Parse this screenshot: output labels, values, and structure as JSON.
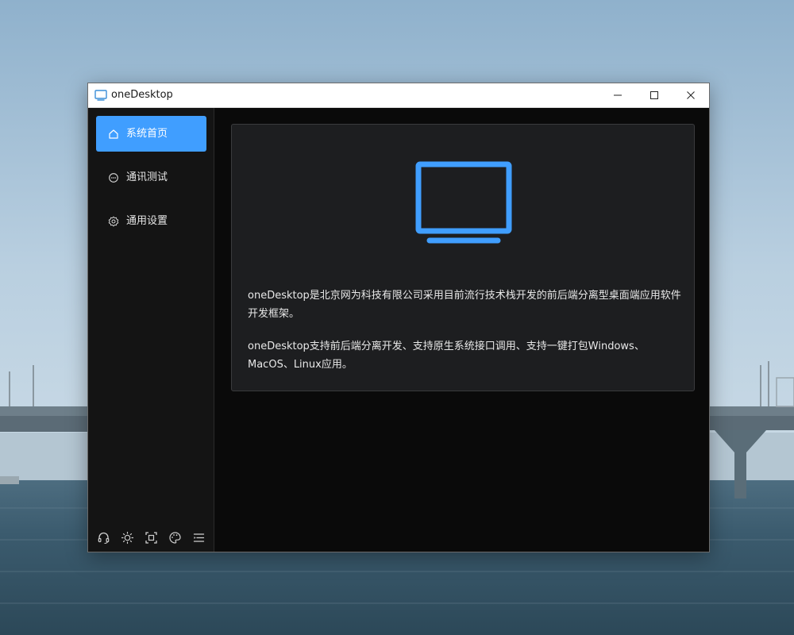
{
  "window": {
    "title": "oneDesktop"
  },
  "sidebar": {
    "items": [
      {
        "label": "系统首页",
        "icon": "home-icon",
        "active": true
      },
      {
        "label": "通讯测试",
        "icon": "chat-icon",
        "active": false
      },
      {
        "label": "通用设置",
        "icon": "gear-icon",
        "active": false
      }
    ],
    "toolbar": [
      "headset-icon",
      "brightness-icon",
      "screenshot-icon",
      "palette-icon",
      "menu-icon"
    ]
  },
  "main": {
    "card": {
      "icon": "monitor-icon",
      "paragraphs": [
        "oneDesktop是北京网为科技有限公司采用目前流行技术栈开发的前后端分离型桌面端应用软件开发框架。",
        "oneDesktop支持前后端分离开发、支持原生系统接口调用、支持一键打包Windows、MacOS、Linux应用。"
      ]
    }
  },
  "colors": {
    "accent": "#409eff",
    "sidebar_bg": "#141414",
    "main_bg": "#0a0a0a",
    "card_bg": "#1d1e20"
  }
}
